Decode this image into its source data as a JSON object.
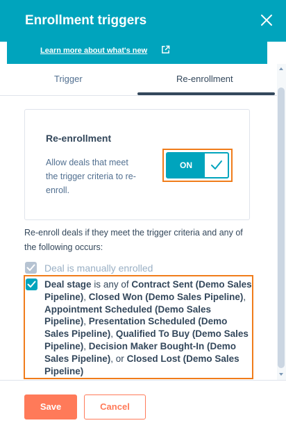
{
  "header": {
    "title": "Enrollment triggers",
    "close_icon": "close-icon"
  },
  "banner": {
    "link_text": "Learn more about what's new",
    "link_icon": "external-link-icon"
  },
  "tabs": [
    {
      "label": "Trigger",
      "active": false
    },
    {
      "label": "Re-enrollment",
      "active": true
    }
  ],
  "reenrollment_card": {
    "heading": "Re-enrollment",
    "description": "Allow deals that meet the trigger criteria to re-enroll.",
    "toggle": {
      "label": "ON",
      "state": true
    }
  },
  "criteria_intro": "Re-enroll deals if they meet the trigger criteria and any of the following occurs:",
  "options": [
    {
      "label": "Deal is manually enrolled",
      "checked": true,
      "disabled": true
    },
    {
      "checked": true,
      "disabled": false,
      "property": "Deal stage",
      "operator": "is any of",
      "values": [
        "Contract Sent (Demo Sales Pipeline)",
        "Closed Won (Demo Sales Pipeline)",
        "Appointment Scheduled (Demo Sales Pipeline)",
        "Presentation Scheduled (Demo Sales Pipeline)",
        "Qualified To Buy (Demo Sales Pipeline)",
        "Decision Maker Bought-In (Demo Sales Pipeline)"
      ],
      "conjunction": ", or",
      "last_value": "Closed Lost (Demo Sales Pipeline)"
    }
  ],
  "footer": {
    "save_label": "Save",
    "cancel_label": "Cancel"
  },
  "colors": {
    "brand": "#00a4bd",
    "accent": "#ff7a59",
    "highlight": "#f07c1a",
    "text": "#33475b"
  }
}
